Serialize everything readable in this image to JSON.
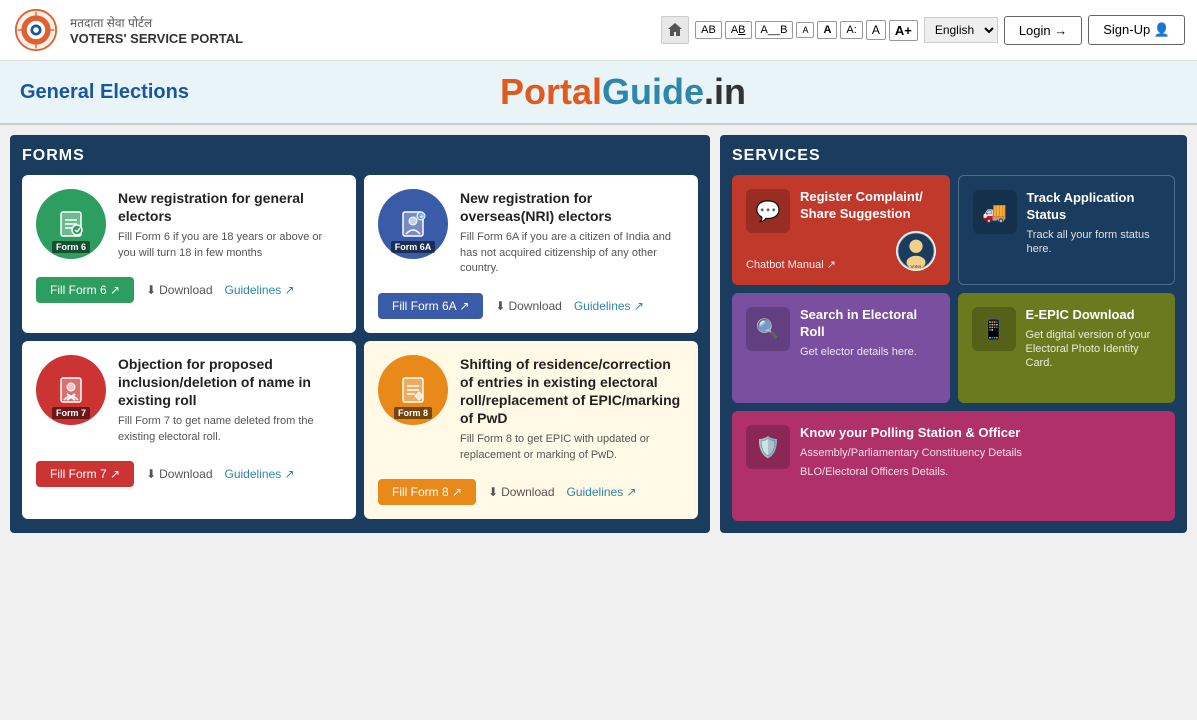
{
  "header": {
    "logo_hindi": "मतदाता सेवा पोर्टल",
    "logo_english": "VOTERS' SERVICE PORTAL",
    "login_label": "Login →",
    "signup_label": "Sign-Up 👤",
    "language": "English",
    "accessibility": [
      "AB",
      "A_B",
      "A__B",
      "A",
      "A",
      "A:",
      "A",
      "A+"
    ]
  },
  "banner": {
    "title": "General Elections",
    "portal_guide": "PortalGuide.in"
  },
  "forms": {
    "section_title": "FORMS",
    "cards": [
      {
        "id": "form6",
        "color": "green",
        "form_label": "Form 6",
        "title": "New registration for general electors",
        "desc": "Fill Form 6 if you are 18 years or above or you will turn 18 in few months",
        "fill_label": "Fill Form 6 ↗",
        "download_label": "Download",
        "guidelines_label": "Guidelines ↗",
        "bg": "white"
      },
      {
        "id": "form6a",
        "color": "blue",
        "form_label": "Form 6A",
        "title": "New registration for overseas(NRI) electors",
        "desc": "Fill Form 6A if you are a citizen of India and has not acquired citizenship of any other country.",
        "fill_label": "Fill Form 6A ↗",
        "download_label": "Download",
        "guidelines_label": "Guidelines ↗",
        "bg": "white"
      },
      {
        "id": "form7",
        "color": "red",
        "form_label": "Form 7",
        "title": "Objection for proposed inclusion/deletion of name in existing roll",
        "desc": "Fill Form 7 to get name deleted from the existing electoral roll.",
        "fill_label": "Fill Form 7 ↗",
        "download_label": "Download",
        "guidelines_label": "Guidelines ↗",
        "bg": "white"
      },
      {
        "id": "form8",
        "color": "orange",
        "form_label": "Form 8",
        "title": "Shifting of residence/correction of entries in existing electoral roll/replacement of EPIC/marking of PwD",
        "desc": "Fill Form 8 to get EPIC with updated or replacement or marking of PwD.",
        "fill_label": "Fill Form 8 ↗",
        "download_label": "Download",
        "guidelines_label": "Guidelines ↗",
        "bg": "yellow"
      }
    ]
  },
  "services": {
    "section_title": "SERVICES",
    "cards": [
      {
        "id": "register-complaint",
        "color": "red-dark",
        "icon": "💬",
        "title": "Register Complaint/ Share Suggestion",
        "desc": "",
        "link": "Chatbot Manual ↗",
        "extra": ""
      },
      {
        "id": "track-application",
        "color": "navy",
        "icon": "🚚",
        "title": "Track Application Status",
        "desc": "Track all your form status here.",
        "link": "",
        "extra": ""
      },
      {
        "id": "search-electoral",
        "color": "purple",
        "icon": "🔍",
        "title": "Search in Electoral Roll",
        "desc": "Get elector details here.",
        "link": "",
        "extra": ""
      },
      {
        "id": "e-epic",
        "color": "olive",
        "icon": "📱",
        "title": "E-EPIC Download",
        "desc": "Get digital version of your Electoral Photo Identity Card.",
        "link": "",
        "extra": ""
      },
      {
        "id": "polling-station",
        "color": "magenta-wide",
        "icon": "🛡️",
        "title": "Know your Polling Station & Officer",
        "desc": "Assembly/Parliamentary Constituency Details",
        "extra": "BLO/Electoral Officers Details.",
        "link": ""
      }
    ]
  }
}
